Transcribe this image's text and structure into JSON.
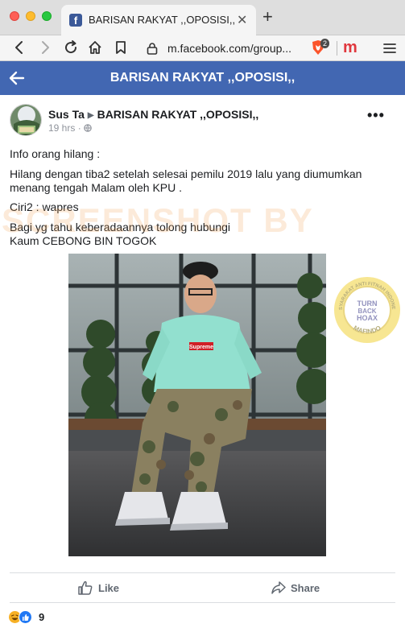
{
  "browser": {
    "tab_title": "BARISAN RAKYAT ,,OPOSISI,,",
    "tab_close": "✕",
    "new_tab": "+",
    "url": "m.facebook.com/group...",
    "brave_count": "2",
    "ext_letter": "m"
  },
  "fb": {
    "header_title": "BARISAN RAKYAT ,,OPOSISI,,"
  },
  "post": {
    "author": "Sus Ta",
    "group": "BARISAN RAKYAT ,,OPOSISI,,",
    "time": "19 hrs",
    "lines": [
      "Info orang hilang :",
      "Hilang dengan tiba2 setelah selesai pemilu 2019 lalu yang diumumkan",
      "menang tengah Malam oleh KPU .",
      "Ciri2 : wapres",
      "Bagi yg tahu keberadaannya tolong hubungi",
      "Kaum CEBONG BIN TOGOK"
    ],
    "hoodie_label": "Supreme",
    "reaction_count": "9"
  },
  "actions": {
    "like_label": "Like",
    "share_label": "Share"
  },
  "watermarks": {
    "screenshot_text": "SCREENSHOT BY",
    "seal_top": "MASYARAKAT ANTI FITNAH INDONESIA",
    "seal_center_1": "TURN",
    "seal_center_2": "BACK",
    "seal_center_3": "HOAX",
    "seal_bottom": "MAFINDO"
  },
  "colors": {
    "fb_blue": "#4267b2",
    "text": "#1c1e21",
    "muted": "#90949c"
  }
}
